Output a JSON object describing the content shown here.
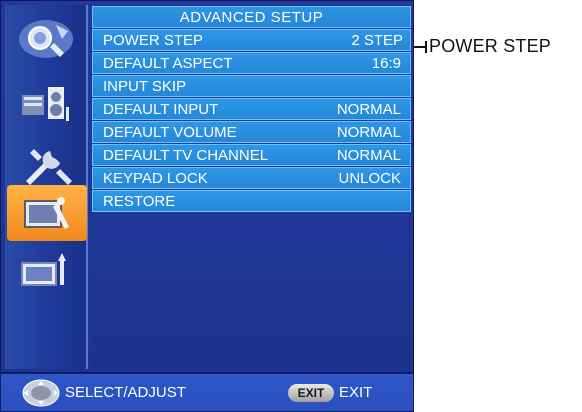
{
  "menu": {
    "title": "ADVANCED SETUP",
    "items": [
      {
        "label": "POWER STEP",
        "value": "2 STEP"
      },
      {
        "label": "DEFAULT ASPECT",
        "value": "16:9"
      },
      {
        "label": "INPUT SKIP",
        "value": ""
      },
      {
        "label": "DEFAULT INPUT",
        "value": "NORMAL"
      },
      {
        "label": "DEFAULT VOLUME",
        "value": "NORMAL"
      },
      {
        "label": "DEFAULT TV CHANNEL",
        "value": "NORMAL"
      },
      {
        "label": "KEYPAD LOCK",
        "value": "UNLOCK"
      },
      {
        "label": "RESTORE",
        "value": ""
      }
    ]
  },
  "sidebar": {
    "items": [
      {
        "icon": "picture-icon",
        "active": false
      },
      {
        "icon": "audio-icon",
        "active": false
      },
      {
        "icon": "setup-tools-icon",
        "active": false
      },
      {
        "icon": "advanced-setup-icon",
        "active": true
      },
      {
        "icon": "tv-antenna-icon",
        "active": false
      }
    ]
  },
  "footer": {
    "joystick_icon": "joystick-icon",
    "select_label": "SELECT/ADJUST",
    "exit_key": "EXIT",
    "exit_label": "EXIT"
  },
  "callout": {
    "text": "POWER STEP"
  },
  "colors": {
    "panel": "#1f3796",
    "row": "#2a8fe0",
    "active_tab": "#f59a2c"
  }
}
